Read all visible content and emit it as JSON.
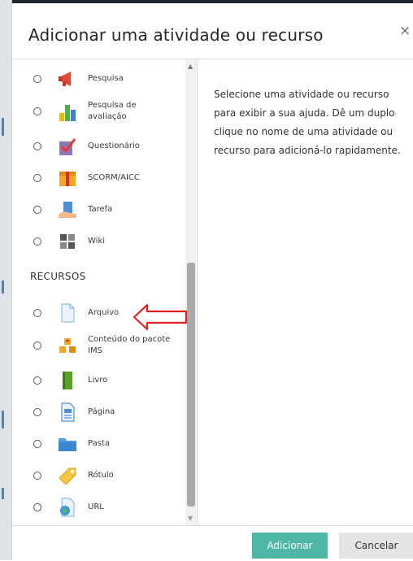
{
  "dialog": {
    "title": "Adicionar uma atividade ou recurso",
    "close_glyph": "×"
  },
  "activities": [
    {
      "label": "Pesquisa",
      "icon": "megaphone-icon"
    },
    {
      "label": "Pesquisa de avaliação",
      "icon": "bar-chart-icon"
    },
    {
      "label": "Questionário",
      "icon": "quiz-checkmark-icon"
    },
    {
      "label": "SCORM/AICC",
      "icon": "scorm-package-icon"
    },
    {
      "label": "Tarefa",
      "icon": "assignment-hand-icon"
    },
    {
      "label": "Wiki",
      "icon": "wiki-puzzle-icon"
    }
  ],
  "resources_section": {
    "heading": "RECURSOS",
    "items": [
      {
        "label": "Arquivo",
        "icon": "file-icon"
      },
      {
        "label": "Conteúdo do pacote IMS",
        "icon": "ims-boxes-icon"
      },
      {
        "label": "Livro",
        "icon": "book-icon"
      },
      {
        "label": "Página",
        "icon": "page-icon"
      },
      {
        "label": "Pasta",
        "icon": "folder-icon"
      },
      {
        "label": "Rótulo",
        "icon": "label-tag-icon"
      },
      {
        "label": "URL",
        "icon": "url-globe-icon"
      }
    ]
  },
  "help_text": "Selecione uma atividade ou recurso para exibir a sua ajuda. Dê um duplo clique no nome de uma atividade ou recurso para adicioná-lo rapidamente.",
  "footer": {
    "add_label": "Adicionar",
    "cancel_label": "Cancelar"
  },
  "annotation": {
    "type": "arrow",
    "color": "#e02020",
    "points_to": "Arquivo"
  },
  "colors": {
    "accent": "#4fb6a6",
    "cancel_bg": "#e4e4e4"
  }
}
